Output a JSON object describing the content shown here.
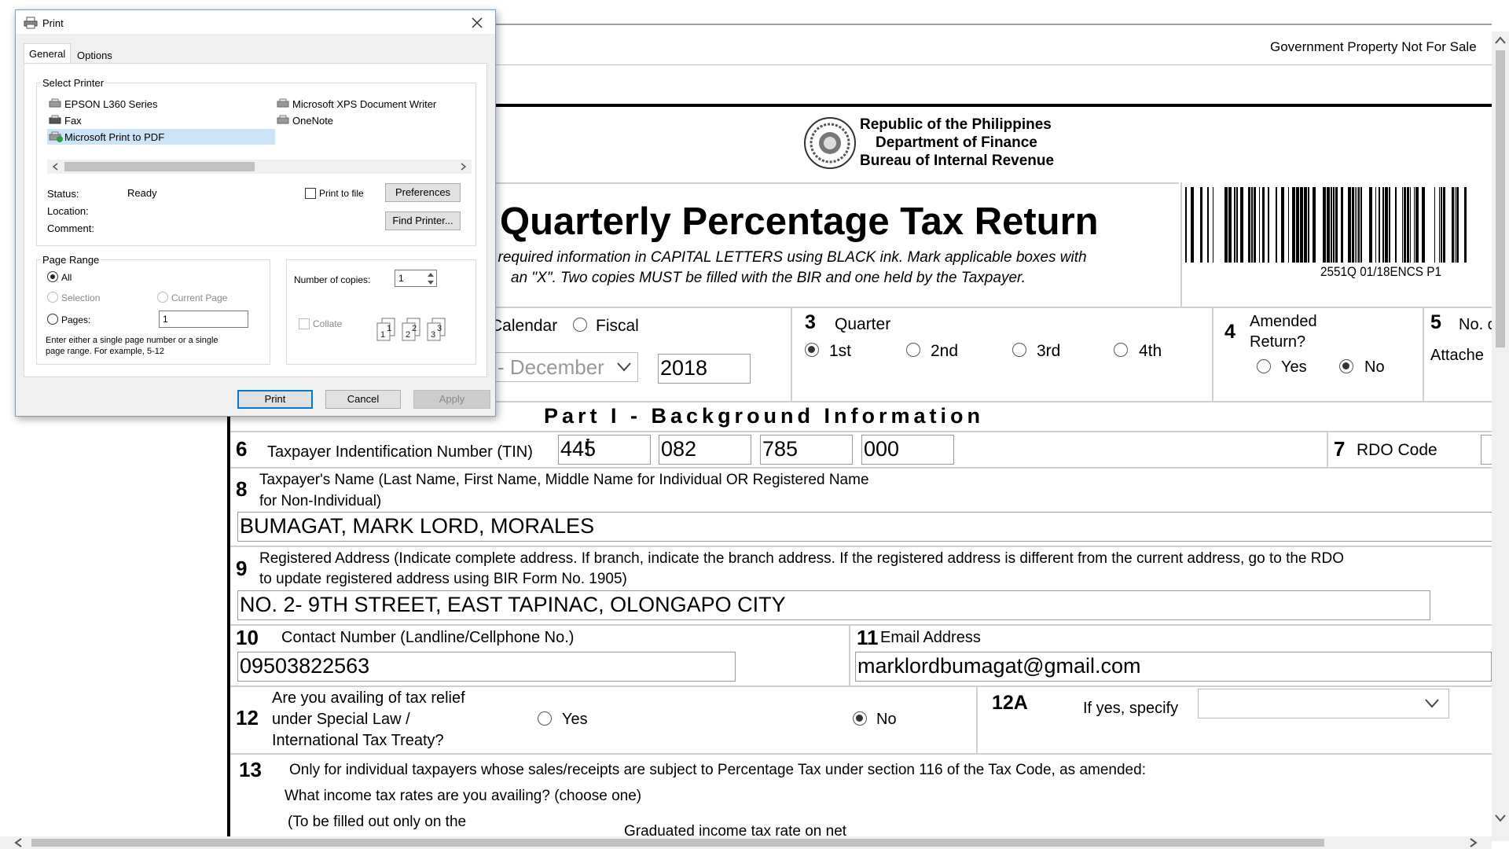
{
  "header": {
    "gov_text": "Government Property Not For Sale"
  },
  "agency": {
    "line1": "Republic of the Philippines",
    "line2": "Department of Finance",
    "line3": "Bureau of Internal Revenue"
  },
  "form": {
    "title": "Quarterly Percentage Tax Return",
    "instr1": "l required information in CAPITAL LETTERS using BLACK ink. Mark applicable boxes with",
    "instr2": "an \"X\". Two copies MUST be filled with the BIR and one held by the Taxpayer.",
    "barcode_code": "2551Q 01/18ENCS P1"
  },
  "row2": {
    "calendar_label": "Calendar",
    "fiscal_label": "Fiscal",
    "month": "- December",
    "year": "2018",
    "q_num": "3",
    "q_label": "Quarter",
    "q1": "1st",
    "q2": "2nd",
    "q3": "3rd",
    "q4": "4th",
    "amend_num": "4",
    "amend_l1": "Amended",
    "amend_l2": "Return?",
    "yes": "Yes",
    "no": "No",
    "f5_num": "5",
    "f5_l1": "No. o",
    "f5_l2": "Attache"
  },
  "part1": {
    "title": "Part I - Background Information"
  },
  "f6": {
    "num": "6",
    "label": "Taxpayer Indentification Number (TIN)",
    "tin1": "445",
    "tin2": "082",
    "tin3": "785",
    "tin4": "000"
  },
  "f7": {
    "num": "7",
    "label": "RDO Code"
  },
  "f8": {
    "num": "8",
    "l1": "Taxpayer's Name (Last Name, First Name, Middle Name for Individual OR Registered Name",
    "l2": "for Non-Individual)",
    "value": "BUMAGAT, MARK LORD, MORALES"
  },
  "f9": {
    "num": "9",
    "l1": "Registered Address (Indicate complete address. If branch, indicate the branch address. If the registered address is different from the current address, go to the RDO",
    "l2": "to update registered address using BIR Form No. 1905)",
    "value": "NO. 2- 9TH STREET, EAST TAPINAC, OLONGAPO CITY"
  },
  "f10": {
    "num": "10",
    "label": "Contact Number (Landline/Cellphone No.)",
    "value": "09503822563"
  },
  "f11": {
    "num": "11",
    "label": "Email Address",
    "value": "marklordbumagat@gmail.com"
  },
  "f12": {
    "num": "12",
    "l1": "Are you availing of tax relief",
    "l2": "under Special Law /",
    "l3": "International Tax Treaty?",
    "yes": "Yes",
    "no": "No"
  },
  "f12a": {
    "num": "12A",
    "label": "If yes, specify"
  },
  "f13": {
    "num": "13",
    "l1": "Only for individual taxpayers whose sales/receipts are subject to Percentage Tax under section 116 of the Tax Code, as amended:",
    "l2": "What income tax rates are you availing? (choose one)",
    "l3": "(To be filled out only on the",
    "l4": "Graduated income tax rate on net"
  },
  "dialog": {
    "title": "Print",
    "tab_general": "General",
    "tab_options": "Options",
    "select_printer": "Select Printer",
    "printers": [
      "EPSON L360 Series",
      "Fax",
      "Microsoft Print to PDF",
      "Microsoft XPS Document Writer",
      "OneNote"
    ],
    "status_label": "Status:",
    "status_value": "Ready",
    "location_label": "Location:",
    "comment_label": "Comment:",
    "print_to_file": "Print to file",
    "preferences": "Preferences",
    "find_printer": "Find Printer...",
    "page_range": "Page Range",
    "all": "All",
    "selection": "Selection",
    "current_page": "Current Page",
    "pages": "Pages:",
    "pages_value": "1",
    "hint1": "Enter either a single page number or a single",
    "hint2": "page range.  For example, 5-12",
    "copies_label": "Number of copies:",
    "copies_value": "1",
    "collate": "Collate",
    "print": "Print",
    "cancel": "Cancel",
    "apply": "Apply"
  },
  "colors": {
    "accent_selection": "#cce4f7",
    "button_focus": "#0078d7"
  }
}
